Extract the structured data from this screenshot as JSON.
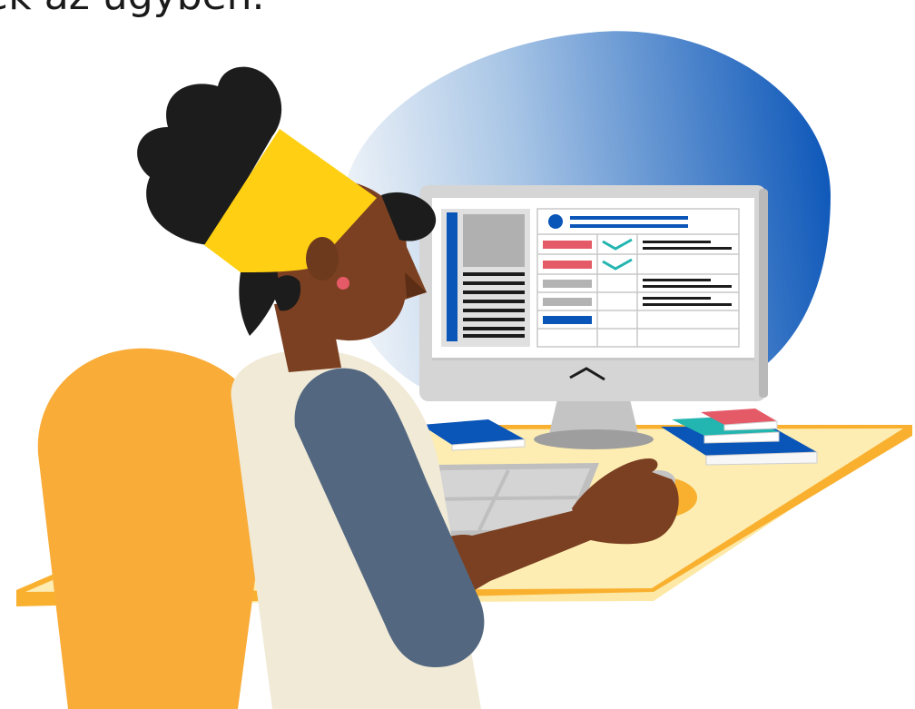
{
  "caption_fragment": "lek az ügyben.",
  "colors": {
    "gradient_start": "#e8eef7",
    "gradient_end": "#0a55b8",
    "desk_top": "#fcecaa",
    "desk_edge": "#f8b232",
    "monitor_frame": "#d9d9d9",
    "monitor_stand": "#bdbdbd",
    "chair": "#f9ac38",
    "skin": "#7b4021",
    "hair": "#1c1c1c",
    "headband": "#fecf12",
    "shirt": "#f1ead7",
    "sleeve": "#536880",
    "accent_blue": "#0a55b8",
    "accent_red": "#e55a67",
    "accent_teal": "#23b5b0"
  },
  "screen_icons": {
    "header": "profile-header-icon",
    "check_1": "checkmark-icon",
    "check_2": "checkmark-icon",
    "chevron": "chevron-down-icon"
  }
}
